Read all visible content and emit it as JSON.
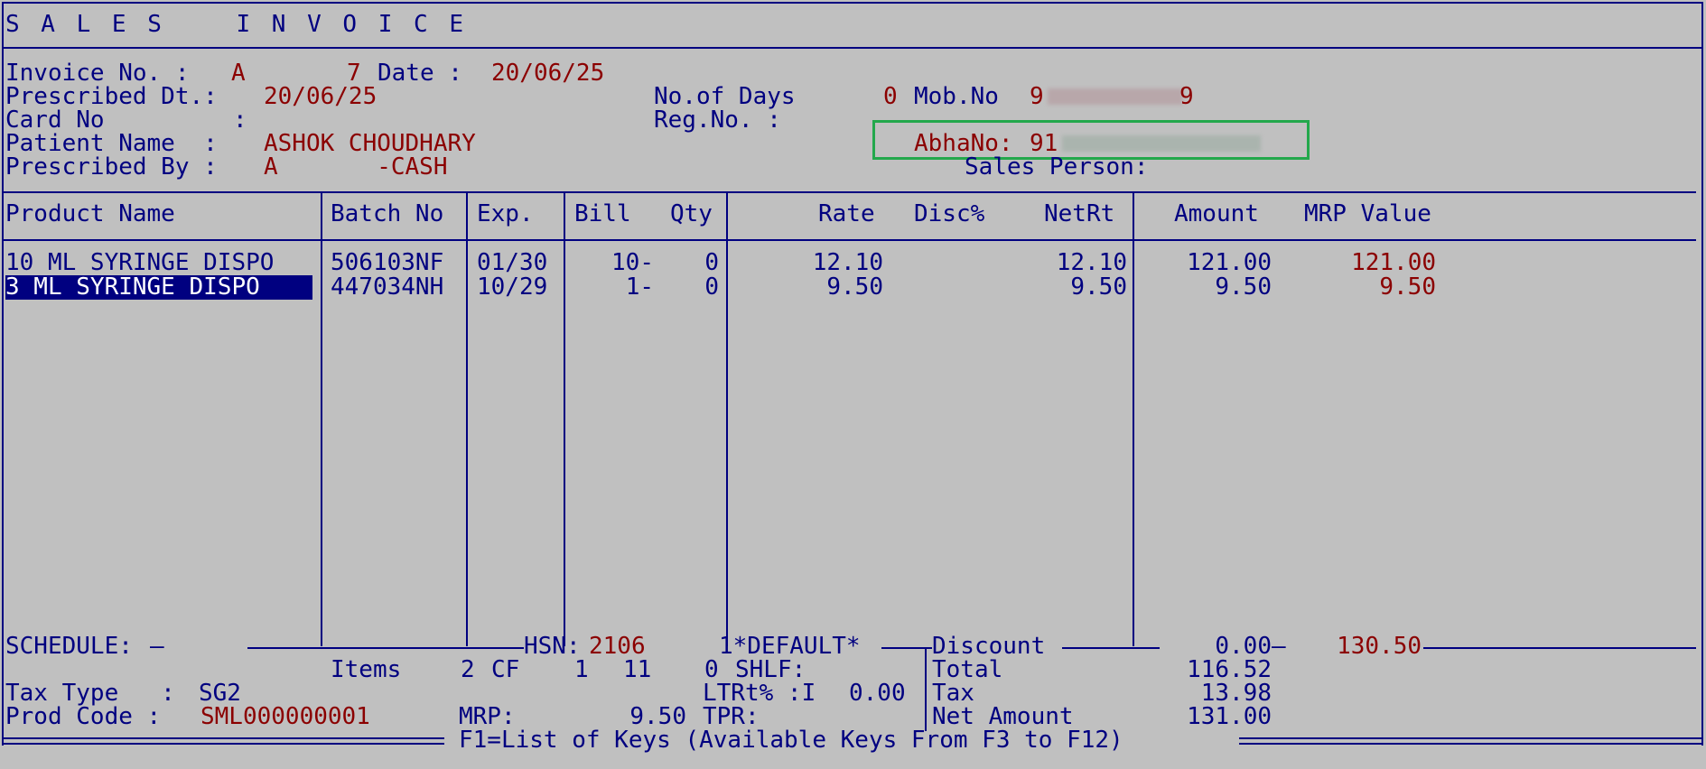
{
  "window": {
    "title": "S A L E S    I N V O I C E"
  },
  "header": {
    "invoice_label": "Invoice No. :",
    "invoice_series": "A",
    "invoice_number": "7",
    "date_label": "Date :",
    "date_value": "20/06/25",
    "prescribed_dt_label": "Prescribed Dt.:",
    "prescribed_dt_value": "20/06/25",
    "no_of_days_label": "No.of Days",
    "no_of_days_value": "0",
    "mob_label": "Mob.No",
    "mob_prefix": "9",
    "mob_suffix": "9",
    "card_label": "Card No",
    "card_sep": ":",
    "reg_label": "Reg.No. :",
    "patient_label": "Patient Name  :",
    "patient_value": "ASHOK CHOUDHARY",
    "abha_label": "AbhaNo:",
    "abha_prefix": "91",
    "prescribed_by_label": "Prescribed By :",
    "prescribed_by_value": "A       -CASH",
    "sales_person_label": "Sales Person:"
  },
  "table": {
    "columns": [
      "Product Name",
      "Batch No",
      "Exp.",
      "Bill",
      "Qty",
      "Rate",
      "Disc%",
      "NetRt",
      "Amount",
      "MRP Value"
    ],
    "rows": [
      {
        "product": "10 ML SYRINGE DISPO",
        "batch": "506103NF",
        "exp": "01/30",
        "bill": "10-",
        "qty": "0",
        "rate": "12.10",
        "disc": "",
        "netrt": "12.10",
        "amount": "121.00",
        "mrp_value": "121.00"
      },
      {
        "product": "3 ML SYRINGE DISPO ",
        "batch": "447034NH",
        "exp": "10/29",
        "bill": "1-",
        "qty": "0",
        "rate": "9.50",
        "disc": "",
        "netrt": "9.50",
        "amount": "9.50",
        "mrp_value": "9.50"
      }
    ]
  },
  "footer": {
    "schedule_label": "SCHEDULE:",
    "schedule_dash": "—",
    "hsn_label": "HSN:",
    "hsn_value": "2106",
    "default_text": "1*DEFAULT*",
    "discount_label": "Discount",
    "discount_value": "0.00",
    "discount_dash": "—",
    "mrp_total": "130.50",
    "items_label": "Items",
    "items_count": "2",
    "cf_label": "CF",
    "cf_value_1": "1",
    "cf_value_2": "11",
    "shelf_prefix": "0",
    "shelf_label": "SHLF:",
    "total_label": "Total",
    "total_value": "116.52",
    "tax_type_label": "Tax Type   :",
    "tax_type_value": "SG2",
    "ltrt_label": "LTRt% :I",
    "ltrt_value": "0.00",
    "tax_label": "Tax",
    "tax_value": "13.98",
    "prod_code_label": "Prod Code :",
    "prod_code_value": "SML000000001",
    "mrp_label": "MRP:",
    "mrp_value": "9.50",
    "tpr_label": "TPR:",
    "net_amount_label": "Net Amount",
    "net_amount_value": "131.00",
    "keys_hint": "F1=List of Keys (Available Keys From F3 to F12)"
  }
}
